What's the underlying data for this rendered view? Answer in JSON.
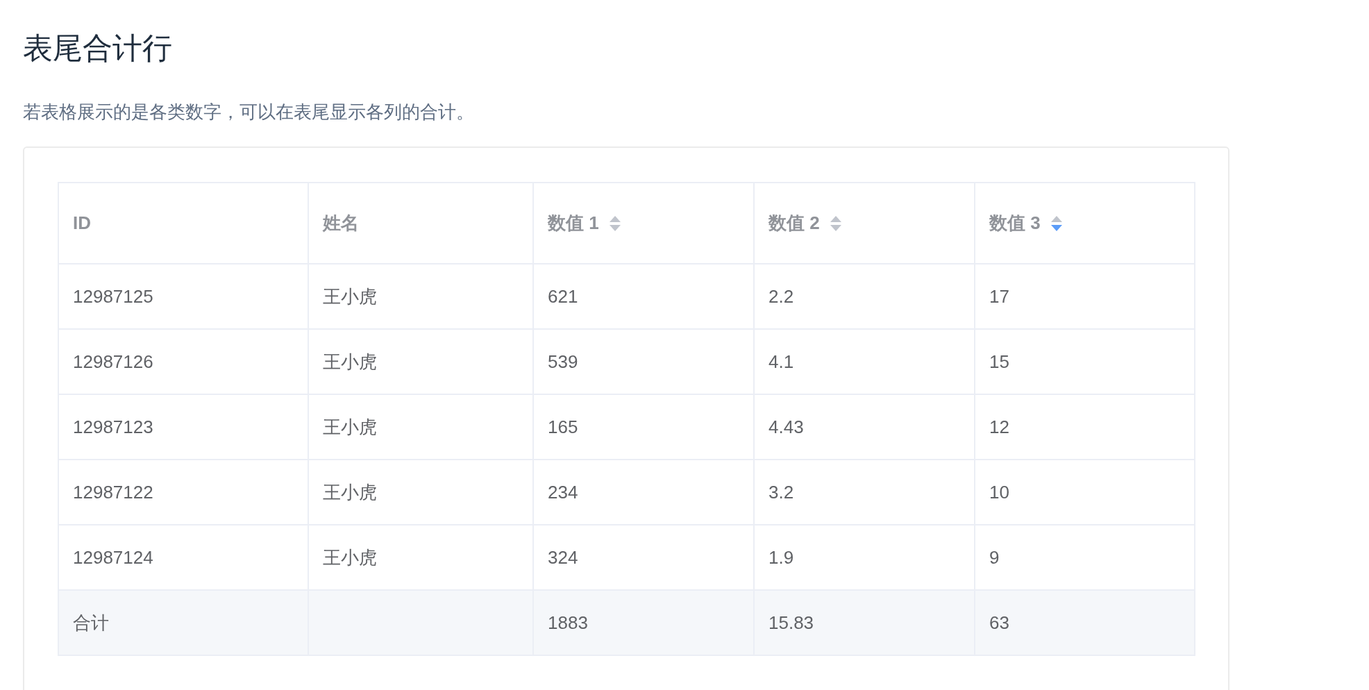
{
  "title": "表尾合计行",
  "description": "若表格展示的是各类数字，可以在表尾显示各列的合计。",
  "table": {
    "columns": [
      {
        "label": "ID"
      },
      {
        "label": "姓名"
      },
      {
        "label": "数值 1",
        "sort_descending": false
      },
      {
        "label": "数值 2",
        "sort_descending": false
      },
      {
        "label": "数值 3",
        "sort_descending": true
      }
    ],
    "rows": [
      [
        "12987125",
        "王小虎",
        "621",
        "2.2",
        "17"
      ],
      [
        "12987126",
        "王小虎",
        "539",
        "4.1",
        "15"
      ],
      [
        "12987123",
        "王小虎",
        "165",
        "4.43",
        "12"
      ],
      [
        "12987122",
        "王小虎",
        "234",
        "3.2",
        "10"
      ],
      [
        "12987124",
        "王小虎",
        "324",
        "1.9",
        "9"
      ]
    ],
    "summary": {
      "label": "合计",
      "totals": [
        "1883",
        "15.83",
        "63"
      ]
    }
  }
}
